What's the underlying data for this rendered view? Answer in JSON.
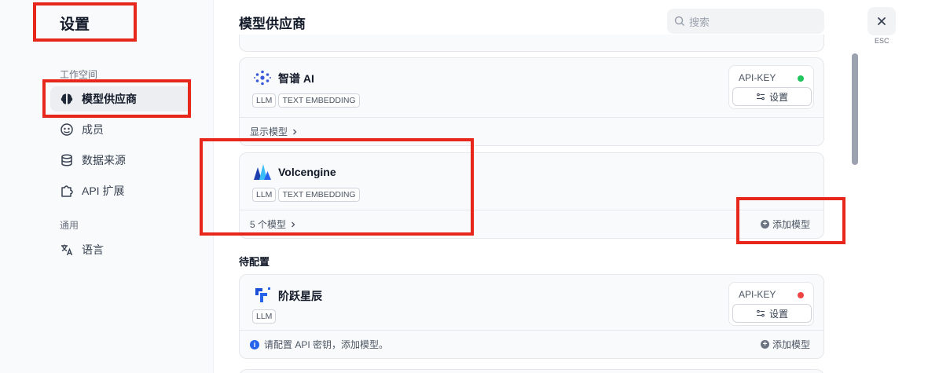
{
  "sidebar": {
    "title": "设置",
    "sections": [
      {
        "label": "工作空间"
      },
      {
        "label": "通用"
      }
    ],
    "items": [
      {
        "label": "模型供应商",
        "icon": "brain-icon",
        "active": true
      },
      {
        "label": "成员",
        "icon": "members-icon"
      },
      {
        "label": "数据来源",
        "icon": "database-icon"
      },
      {
        "label": "API 扩展",
        "icon": "puzzle-icon"
      },
      {
        "label": "语言",
        "icon": "translate-icon"
      }
    ]
  },
  "main": {
    "title": "模型供应商",
    "search_placeholder": "搜索",
    "providers": [
      {
        "name": "智谱 AI",
        "tags": [
          "LLM",
          "TEXT EMBEDDING"
        ],
        "api_label": "API-KEY",
        "api_status_color": "#22c55e",
        "settings_label": "设置",
        "footer_link": "显示模型"
      },
      {
        "name": "Volcengine",
        "tags": [
          "LLM",
          "TEXT EMBEDDING"
        ],
        "footer_link": "5 个模型",
        "add_label": "添加模型"
      }
    ],
    "pending_title": "待配置",
    "pending": [
      {
        "name": "阶跃星辰",
        "tags": [
          "LLM"
        ],
        "api_label": "API-KEY",
        "api_status_color": "#ef4444",
        "settings_label": "设置",
        "notice": "请配置 API 密钥，添加模型。",
        "add_label": "添加模型"
      }
    ]
  },
  "close": {
    "esc_label": "ESC"
  },
  "colors": {
    "highlight": "#e8271c",
    "accent": "#2563eb"
  }
}
